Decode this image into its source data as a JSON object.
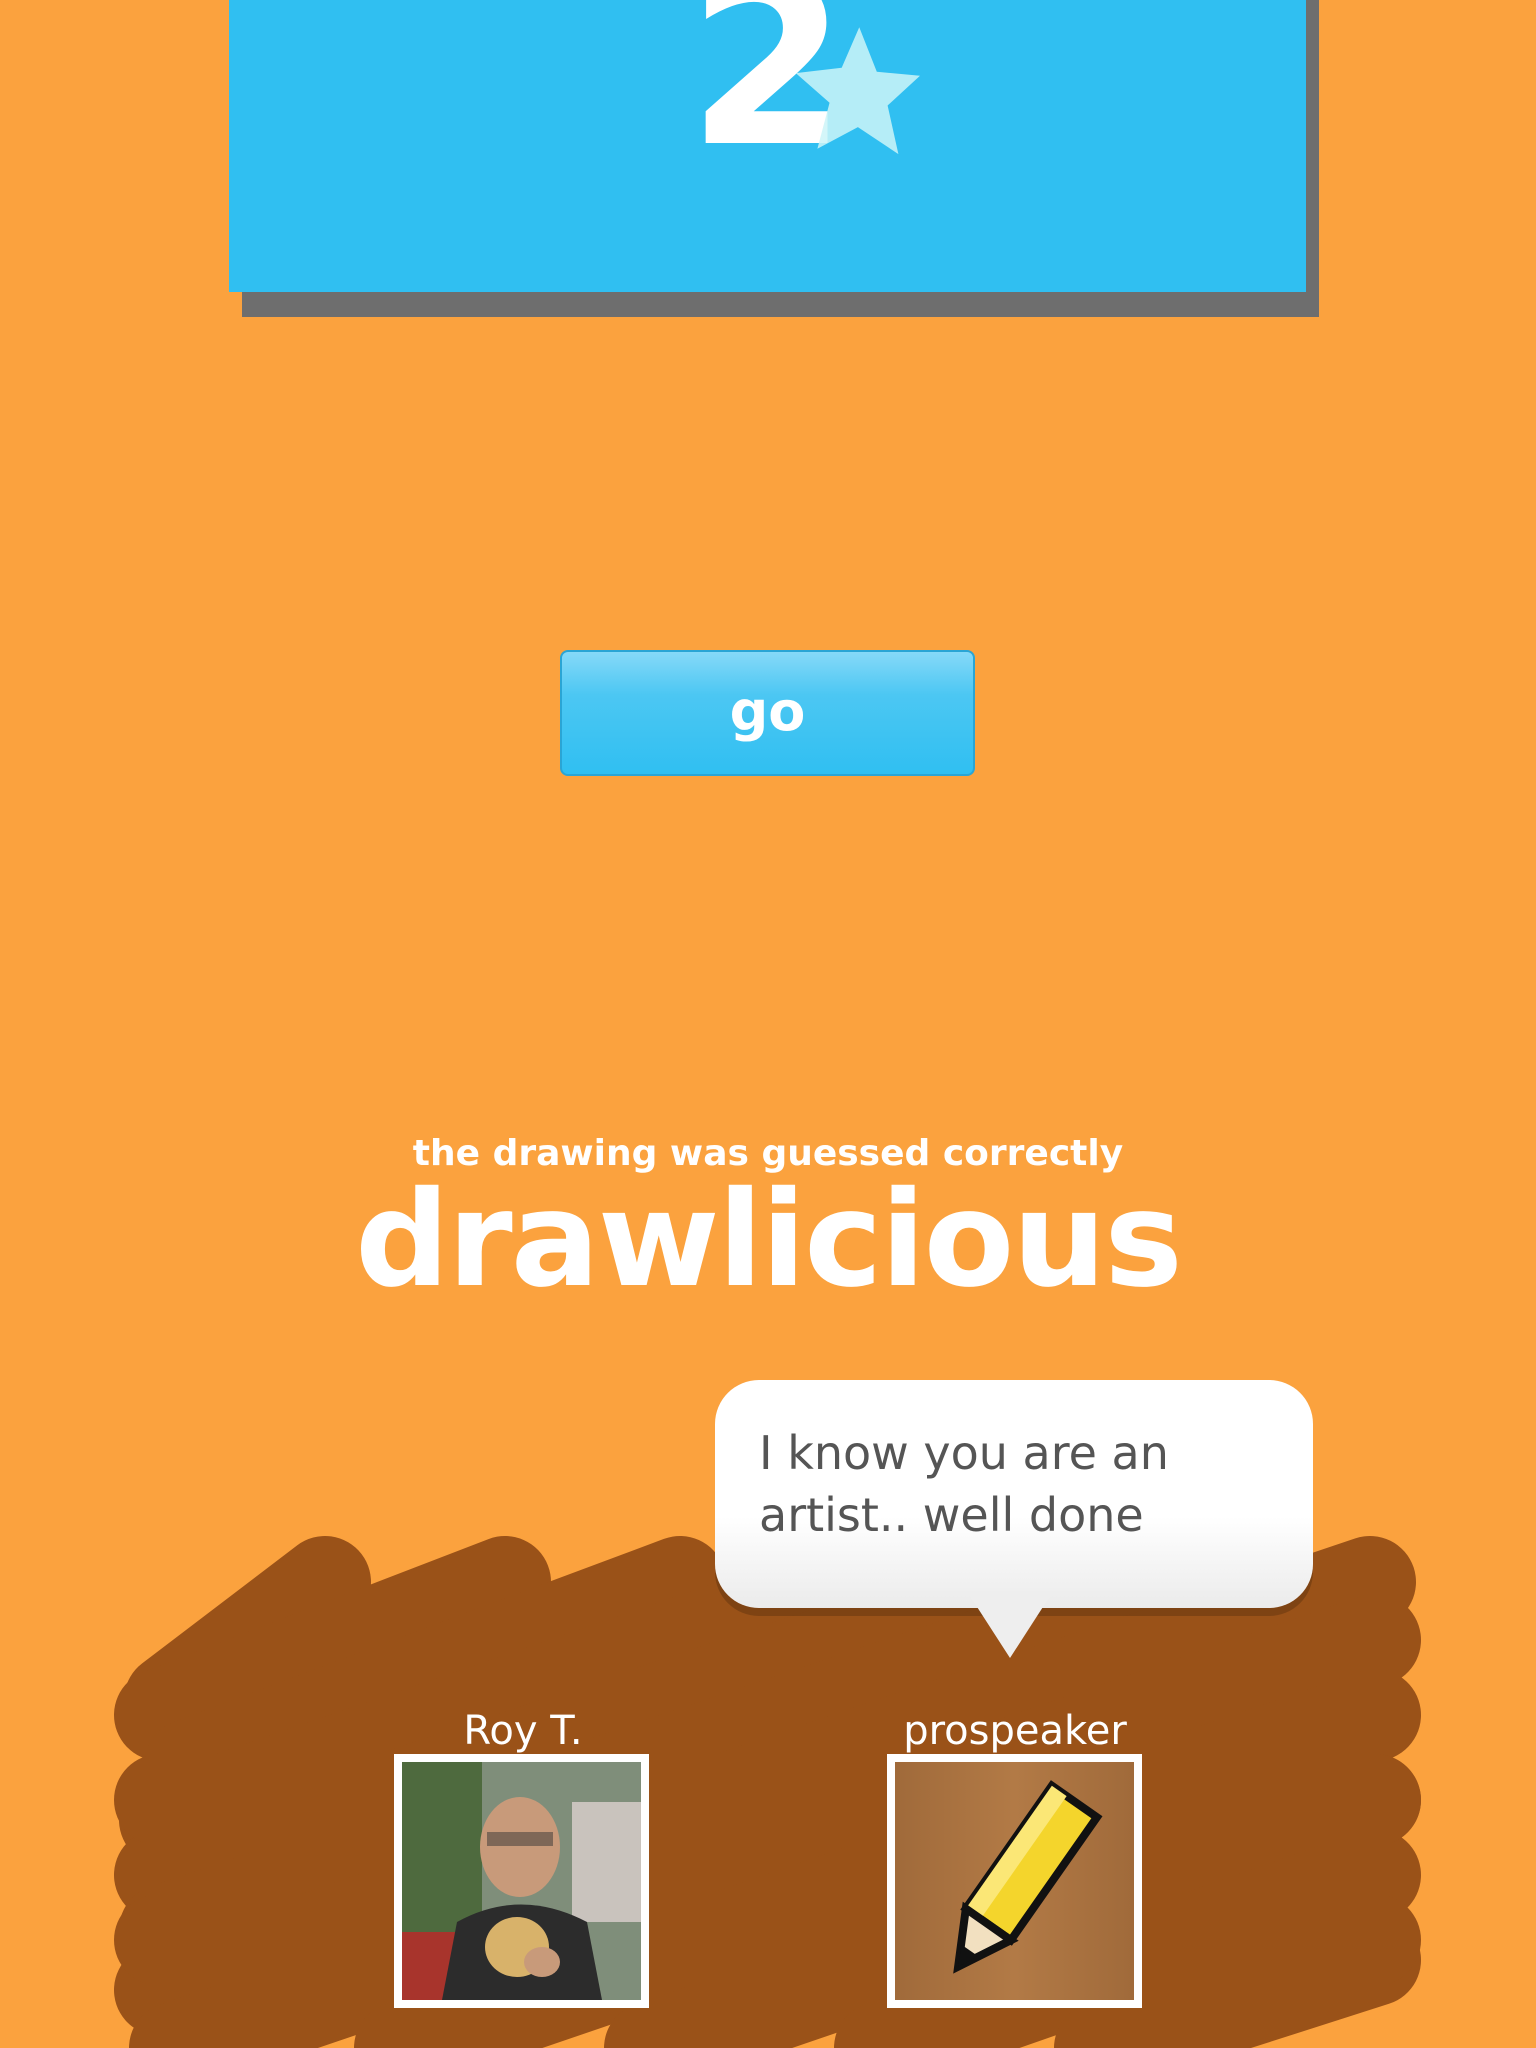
{
  "score": {
    "value": "2"
  },
  "go_button": {
    "label": "go"
  },
  "result": {
    "subtitle": "the drawing was guessed correctly",
    "headline": "drawlicious"
  },
  "message": {
    "text": "I know you are an artist.. well done"
  },
  "players": [
    {
      "name": "Roy T.",
      "avatar": "user-photo"
    },
    {
      "name": "prospeaker",
      "avatar": "pencil-icon"
    }
  ],
  "colors": {
    "background": "#fba23e",
    "score_card": "#30bff1",
    "scribble": "#9a5218",
    "bubble_text": "#555555"
  }
}
